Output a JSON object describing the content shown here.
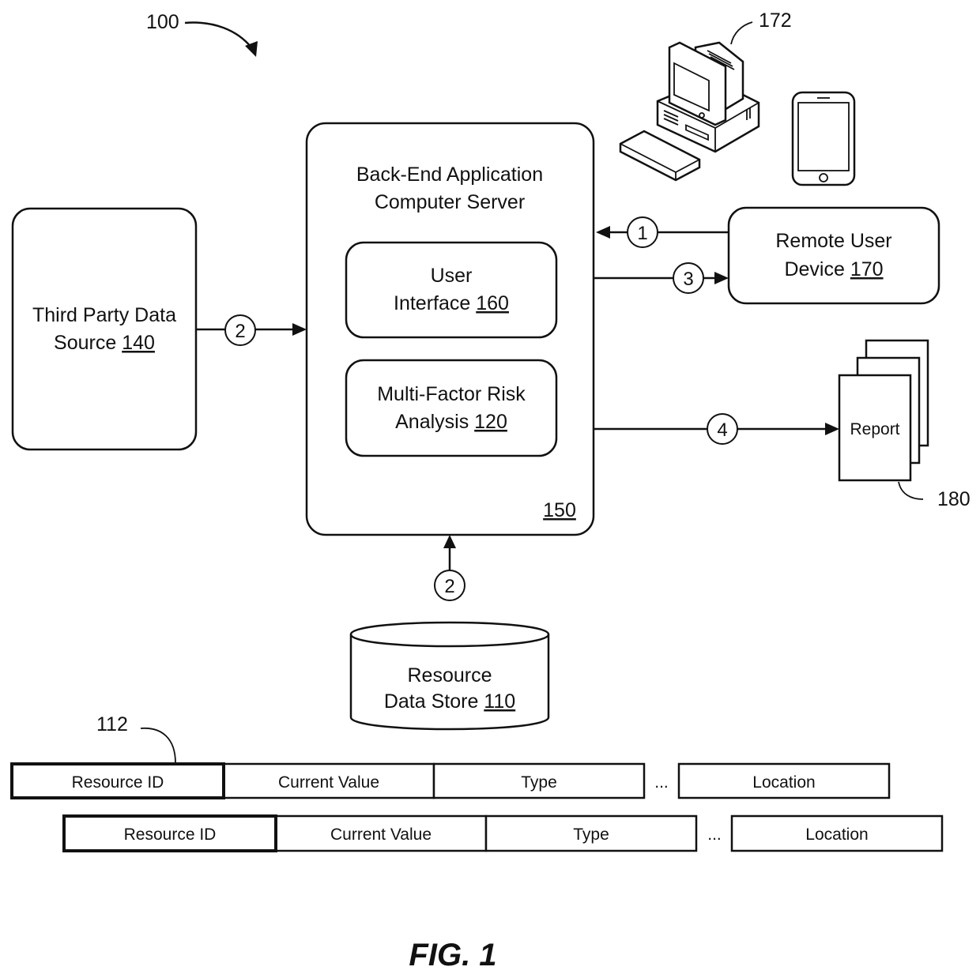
{
  "figure": {
    "caption": "FIG. 1",
    "system_ref": "100"
  },
  "server": {
    "title_line1": "Back-End Application",
    "title_line2": "Computer Server",
    "ref": "150",
    "modules": [
      {
        "line1": "User",
        "line2": "Interface ",
        "ref": "160"
      },
      {
        "line1": "Multi-Factor Risk",
        "line2": "Analysis ",
        "ref": "120"
      }
    ]
  },
  "third_party": {
    "line1": "Third Party Data",
    "line2": "Source ",
    "ref": "140"
  },
  "remote_device": {
    "line1": "Remote User",
    "line2": "Device ",
    "ref": "170",
    "devices_ref": "172",
    "device_icons": [
      "desktop-computer-icon",
      "tablet-icon"
    ]
  },
  "report": {
    "label": "Report",
    "ref": "180"
  },
  "data_store": {
    "line1": "Resource",
    "line2": "Data Store ",
    "ref": "110"
  },
  "records": {
    "ref": "112",
    "ellipsis": "...",
    "rows": [
      {
        "fields": [
          "Resource ID",
          "Current Value",
          "Type",
          "Location"
        ]
      },
      {
        "fields": [
          "Resource ID",
          "Current Value",
          "Type",
          "Location"
        ]
      }
    ]
  },
  "steps": {
    "request": "1",
    "third_party_data": "2",
    "data_store_data": "2",
    "response": "3",
    "report": "4"
  }
}
